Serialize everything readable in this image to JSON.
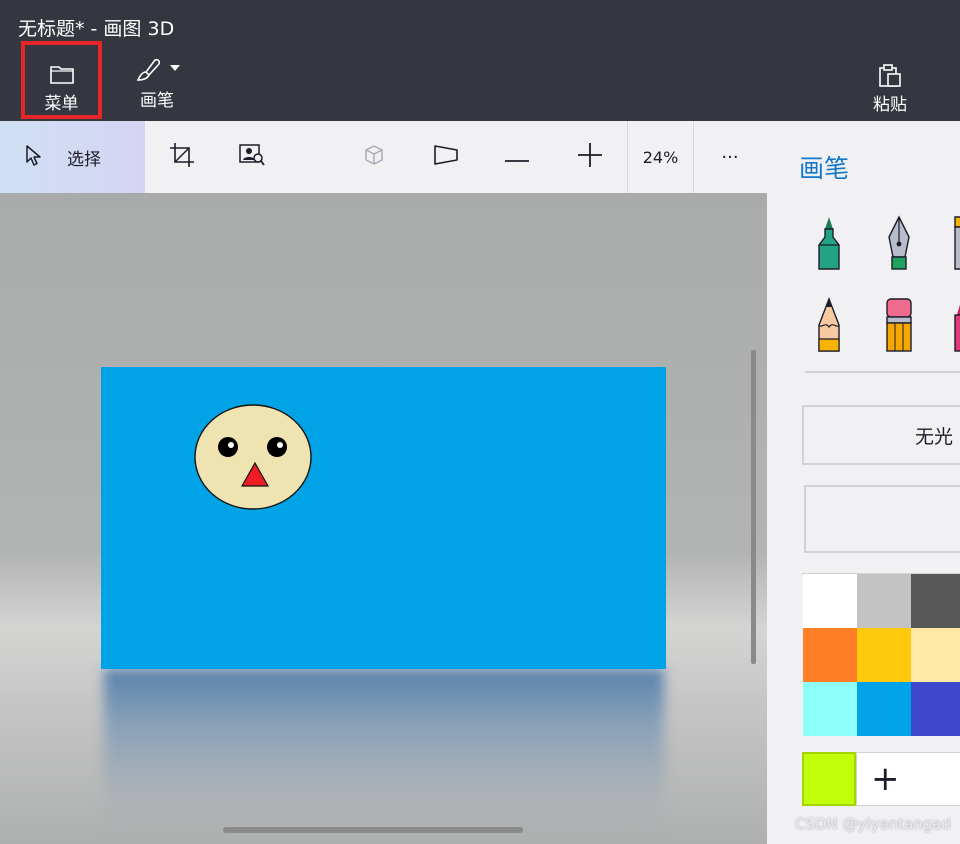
{
  "window": {
    "title": "无标题* - 画图 3D"
  },
  "ribbon": {
    "menu_label": "菜单",
    "brushes_label": "画笔",
    "paste_label": "粘贴"
  },
  "toolbar": {
    "select_label": "选择",
    "zoom": "24%",
    "more_label": "···"
  },
  "canvas": {
    "background_color": "#00a3e6",
    "face_color": "#efe3b2",
    "nose_color": "#ee1d24"
  },
  "panel": {
    "title": "画笔",
    "brushes": [
      "marker-icon",
      "calligraphy-pen-icon",
      "oil-brush-icon",
      "pencil-icon",
      "eraser-icon",
      "crayon-icon"
    ],
    "finish_label": "无光",
    "palette": [
      "#ffffff",
      "#c3c3c3",
      "#585858",
      "#ff7f27",
      "#ffc90e",
      "#ffeaa5",
      "#8cfffb",
      "#00a2e8",
      "#3f48cc"
    ],
    "current_color": "#c2ff0a",
    "add_color_label": "+"
  },
  "watermark": "CSDN @yiyantangad"
}
